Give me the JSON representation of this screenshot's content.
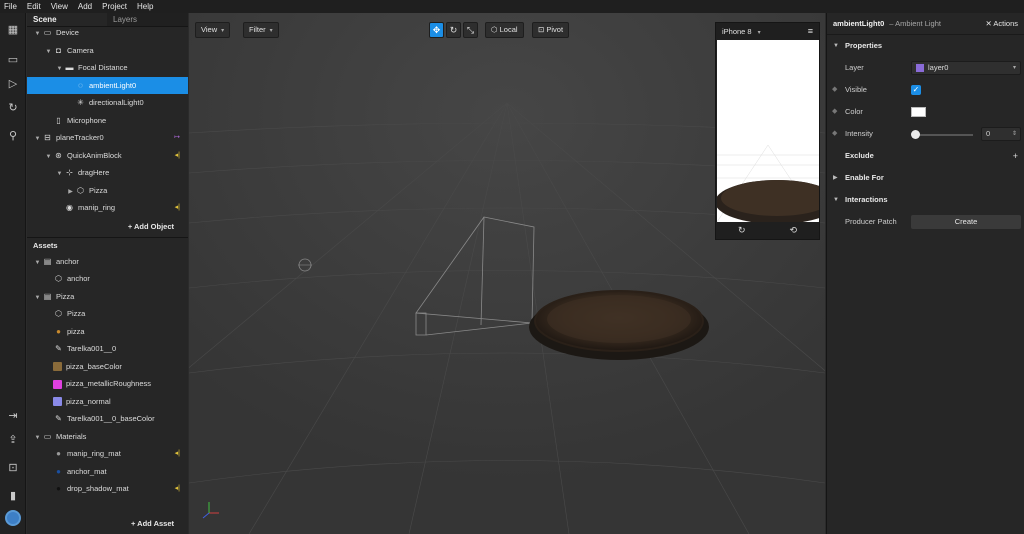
{
  "menu": [
    "File",
    "Edit",
    "View",
    "Add",
    "Project",
    "Help"
  ],
  "scene_panel": {
    "tabs": [
      "Scene",
      "Layers"
    ],
    "tree": [
      {
        "label": "Device",
        "arrow": "▼",
        "icon": "▭",
        "indent": 0
      },
      {
        "label": "Camera",
        "arrow": "▼",
        "icon": "◘",
        "indent": 1
      },
      {
        "label": "Focal Distance",
        "arrow": "▼",
        "icon": "▬",
        "indent": 2
      },
      {
        "label": "ambientLight0",
        "arrow": "",
        "icon": "◌",
        "indent": 3,
        "selected": true
      },
      {
        "label": "directionalLight0",
        "arrow": "",
        "icon": "✳",
        "indent": 3
      },
      {
        "label": "Microphone",
        "arrow": "",
        "icon": "▯",
        "indent": 1
      },
      {
        "label": "planeTracker0",
        "arrow": "▼",
        "icon": "⊟",
        "indent": 0,
        "badge": "↦",
        "badge_color": "purple"
      },
      {
        "label": "QuickAnimBlock",
        "arrow": "▼",
        "icon": "⊛",
        "indent": 1,
        "badge": "◂|"
      },
      {
        "label": "dragHere",
        "arrow": "▼",
        "icon": "⊹",
        "indent": 2
      },
      {
        "label": "Pizza",
        "arrow": "▶",
        "icon": "⬡",
        "indent": 3
      },
      {
        "label": "manip_ring",
        "arrow": "",
        "icon": "◉",
        "indent": 2,
        "badge": "◂|"
      }
    ],
    "add_object": "+ Add Object",
    "assets_title": "Assets",
    "assets": [
      {
        "label": "anchor",
        "arrow": "▼",
        "icon": "▤",
        "indent": 0
      },
      {
        "label": "anchor",
        "arrow": "",
        "icon": "⬡",
        "indent": 1
      },
      {
        "label": "Pizza",
        "arrow": "▼",
        "icon": "▤",
        "indent": 0
      },
      {
        "label": "Pizza",
        "arrow": "",
        "icon": "⬡",
        "indent": 1
      },
      {
        "label": "pizza",
        "arrow": "",
        "icon": "●",
        "indent": 1,
        "color": "#c98a2d"
      },
      {
        "label": "Tarelka001__0",
        "arrow": "",
        "icon": "✎",
        "indent": 1
      },
      {
        "label": "pizza_baseColor",
        "arrow": "",
        "icon": "",
        "indent": 1,
        "swatch": "#8a6b3a"
      },
      {
        "label": "pizza_metallicRoughness",
        "arrow": "",
        "icon": "",
        "indent": 1,
        "swatch": "#e040e0"
      },
      {
        "label": "pizza_normal",
        "arrow": "",
        "icon": "",
        "indent": 1,
        "swatch": "#8a8ae8"
      },
      {
        "label": "Tarelka001__0_baseColor",
        "arrow": "",
        "icon": "✎",
        "indent": 1
      },
      {
        "label": "Materials",
        "arrow": "▼",
        "icon": "▭",
        "indent": 0
      },
      {
        "label": "manip_ring_mat",
        "arrow": "",
        "icon": "●",
        "indent": 1,
        "color": "#9a9a9a",
        "badge": "◂|"
      },
      {
        "label": "anchor_mat",
        "arrow": "",
        "icon": "●",
        "indent": 1,
        "color": "#1a4fa0"
      },
      {
        "label": "drop_shadow_mat",
        "arrow": "",
        "icon": "●",
        "indent": 1,
        "color": "#111111",
        "badge": "◂|"
      }
    ],
    "add_asset": "+ Add Asset"
  },
  "viewport": {
    "view_label": "View",
    "filter_label": "Filter",
    "local_label": "Local",
    "pivot_label": "Pivot"
  },
  "simulator": {
    "device": "iPhone 8",
    "menu_icon": "≡",
    "foot_icons": [
      "↻",
      "⟲"
    ]
  },
  "inspector": {
    "object_name": "ambientLight0",
    "object_type": "– Ambient Light",
    "actions": "✕ Actions",
    "properties_label": "Properties",
    "layer_label": "Layer",
    "layer_value": "layer0",
    "visible_label": "Visible",
    "visible": true,
    "color_label": "Color",
    "color_value": "#ffffff",
    "intensity_label": "Intensity",
    "intensity_value": "0",
    "exclude_label": "Exclude",
    "enable_for_label": "Enable For",
    "interactions_label": "Interactions",
    "producer_patch_label": "Producer Patch",
    "create_label": "Create"
  }
}
